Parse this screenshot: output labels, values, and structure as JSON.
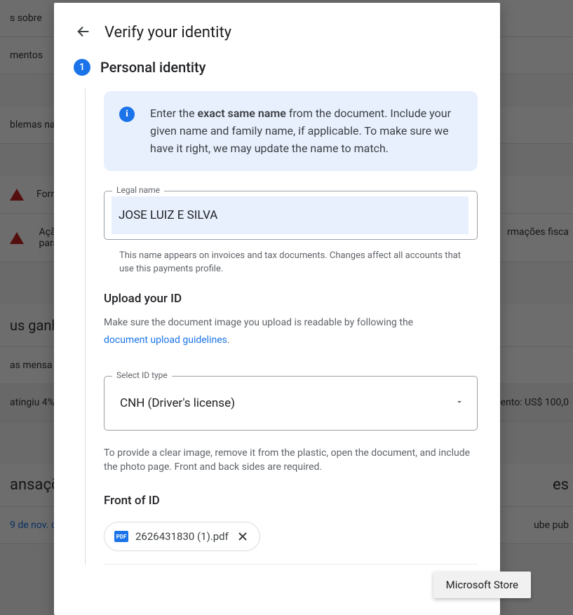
{
  "background": {
    "row1": "s sobre",
    "row2": "mentos",
    "row3": "blemas na",
    "row4": "Forne",
    "row5a": "Ação",
    "row5b": "para",
    "row_right": "rmações fisca",
    "row6": "us ganho",
    "row7": "as mensa",
    "row8_left": "atingiu 4%",
    "row8_right": "ento: US$ 100,0",
    "row9": "ansaçõ",
    "row9_right": "es",
    "row10_blue": "9 de nov. d",
    "row10_right": "ube pub"
  },
  "modal": {
    "title": "Verify your identity",
    "step_number": "1",
    "step_title": "Personal identity",
    "info_prefix": "Enter the ",
    "info_bold": "exact same name",
    "info_suffix": " from the document. Include your given name and family name, if applicable. To make sure we have it right, we may update the name to match.",
    "legal_name_label": "Legal name",
    "legal_name_value": "JOSE LUIZ E SILVA",
    "legal_name_helper": "This name appears on invoices and tax documents. Changes affect all accounts that use this payments profile.",
    "upload_heading": "Upload your ID",
    "upload_desc": "Make sure the document image you upload is readable by following the ",
    "upload_link": "document upload guidelines",
    "select_label": "Select ID type",
    "select_value": "CNH (Driver's license)",
    "select_hint": "To provide a clear image, remove it from the plastic, open the document, and include the photo page. Front and back sides are required.",
    "front_heading": "Front of ID",
    "file_badge": "PDF",
    "file_name": "2626431830 (1).pdf"
  },
  "toast": {
    "text": "Microsoft Store"
  }
}
